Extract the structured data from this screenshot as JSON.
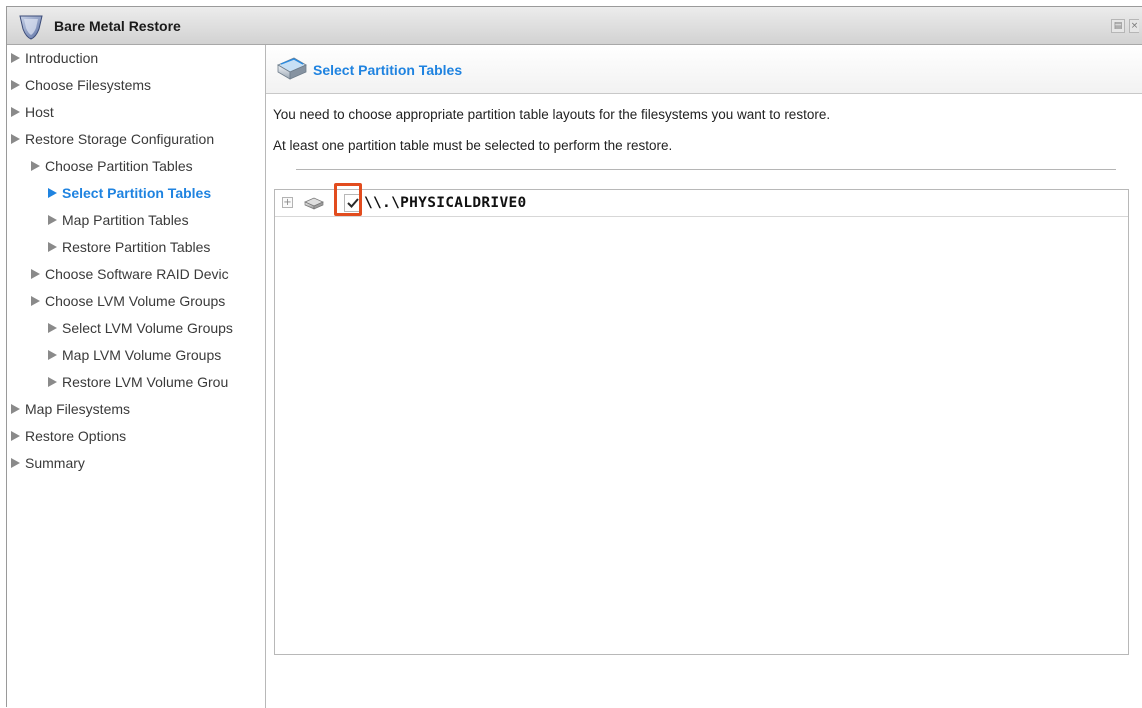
{
  "window": {
    "title": "Bare Metal Restore"
  },
  "sidebar": {
    "items": [
      {
        "label": "Introduction",
        "level": 0,
        "active": false
      },
      {
        "label": "Choose Filesystems",
        "level": 0,
        "active": false
      },
      {
        "label": "Host",
        "level": 0,
        "active": false
      },
      {
        "label": "Restore Storage Configuration",
        "level": 0,
        "active": false
      },
      {
        "label": "Choose Partition Tables",
        "level": 1,
        "active": false
      },
      {
        "label": "Select Partition Tables",
        "level": 2,
        "active": true
      },
      {
        "label": "Map Partition Tables",
        "level": 2,
        "active": false
      },
      {
        "label": "Restore Partition Tables",
        "level": 2,
        "active": false
      },
      {
        "label": "Choose Software RAID Devic",
        "level": 1,
        "active": false
      },
      {
        "label": "Choose LVM Volume Groups",
        "level": 1,
        "active": false
      },
      {
        "label": "Select LVM Volume Groups",
        "level": 2,
        "active": false
      },
      {
        "label": "Map LVM Volume Groups",
        "level": 2,
        "active": false
      },
      {
        "label": "Restore LVM Volume Grou",
        "level": 2,
        "active": false
      },
      {
        "label": "Map Filesystems",
        "level": 0,
        "active": false
      },
      {
        "label": "Restore Options",
        "level": 0,
        "active": false
      },
      {
        "label": "Summary",
        "level": 0,
        "active": false
      }
    ]
  },
  "main": {
    "header_title": "Select Partition Tables",
    "description_1": "You need to choose appropriate partition table layouts for the filesystems you want to restore.",
    "description_2": "At least one partition table must be selected to perform the restore.",
    "tree": {
      "rows": [
        {
          "label": "\\\\.\\PHYSICALDRIVE0",
          "checked": true,
          "expanded": false
        }
      ]
    }
  },
  "colors": {
    "accent": "#1f83e0",
    "highlight": "#e24c1e"
  },
  "icons": {
    "title": "shield-icon",
    "header": "drive-stack-icon",
    "nav": "triangle-right-icon",
    "disk": "disk-icon",
    "expand": "plus-icon",
    "check": "checkmark-icon"
  }
}
